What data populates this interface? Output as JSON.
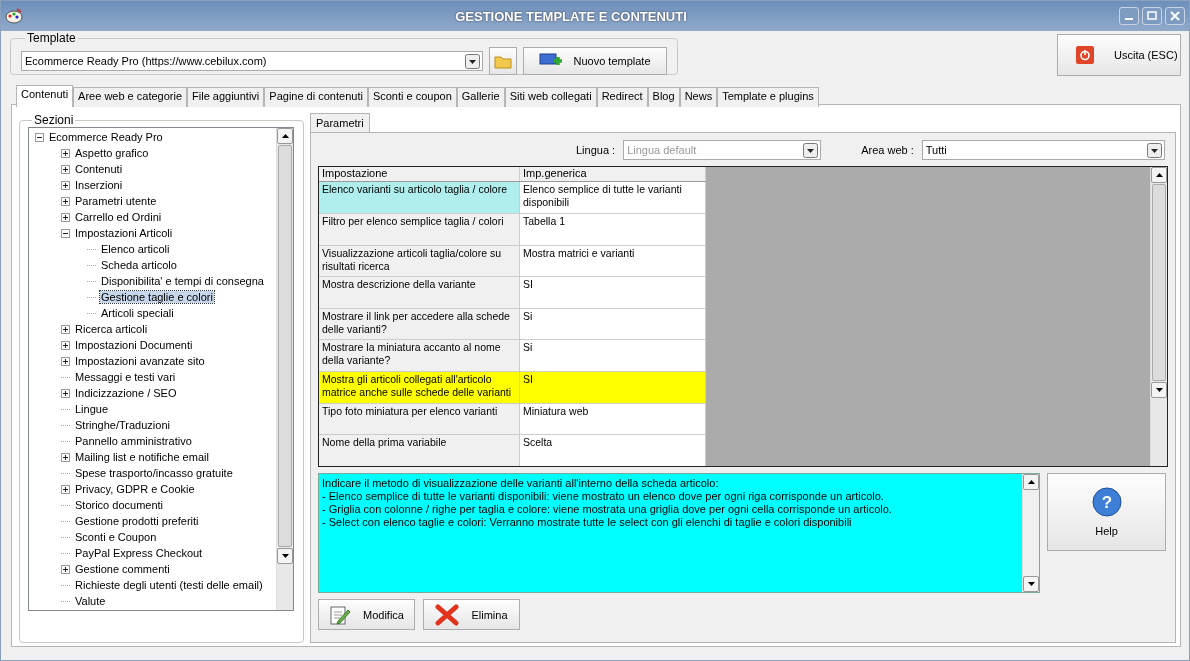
{
  "window": {
    "title": "GESTIONE TEMPLATE E CONTENUTI"
  },
  "template": {
    "label": "Template",
    "value": "Ecommerce Ready Pro (https://www.cebilux.com)",
    "new_button": "Nuovo template"
  },
  "exit_button": "Uscita (ESC)",
  "tabs": [
    {
      "label": "Contenuti",
      "selected": true
    },
    {
      "label": "Aree web e categorie",
      "selected": false
    },
    {
      "label": "File aggiuntivi",
      "selected": false
    },
    {
      "label": "Pagine di contenuti",
      "selected": false
    },
    {
      "label": "Sconti e coupon",
      "selected": false
    },
    {
      "label": "Gallerie",
      "selected": false
    },
    {
      "label": "Siti web collegati",
      "selected": false
    },
    {
      "label": "Redirect",
      "selected": false
    },
    {
      "label": "Blog",
      "selected": false
    },
    {
      "label": "News",
      "selected": false
    },
    {
      "label": "Template e plugins",
      "selected": false
    }
  ],
  "sidebar": {
    "title": "Sezioni",
    "items": [
      {
        "label": "Ecommerce Ready Pro",
        "expanded": true,
        "selected": false,
        "children": [
          {
            "label": "Aspetto grafico",
            "expanded": false,
            "selected": false
          },
          {
            "label": "Contenuti",
            "expanded": false,
            "selected": false
          },
          {
            "label": "Inserzioni",
            "expanded": false,
            "selected": false
          },
          {
            "label": "Parametri utente",
            "expanded": false,
            "selected": false
          },
          {
            "label": "Carrello ed Ordini",
            "expanded": false,
            "selected": false
          },
          {
            "label": "Impostazioni Articoli",
            "expanded": true,
            "selected": false,
            "children": [
              {
                "label": "Elenco articoli",
                "selected": false
              },
              {
                "label": "Scheda articolo",
                "selected": false
              },
              {
                "label": "Disponibilita' e tempi di consegna",
                "selected": false
              },
              {
                "label": "Gestione taglie e colori",
                "selected": true
              },
              {
                "label": "Articoli speciali",
                "selected": false
              }
            ]
          },
          {
            "label": "Ricerca articoli",
            "expanded": false,
            "selected": false
          },
          {
            "label": "Impostazioni Documenti",
            "expanded": false,
            "selected": false
          },
          {
            "label": "Impostazioni avanzate sito",
            "expanded": false,
            "selected": false
          },
          {
            "label": "Messaggi e testi vari",
            "selected": false
          },
          {
            "label": "Indicizzazione / SEO",
            "expanded": false,
            "selected": false
          },
          {
            "label": "Lingue",
            "selected": false
          },
          {
            "label": "Stringhe/Traduzioni",
            "selected": false
          },
          {
            "label": "Pannello amministrativo",
            "selected": false
          },
          {
            "label": "Mailing list e notifiche email",
            "expanded": false,
            "selected": false
          },
          {
            "label": "Spese trasporto/incasso gratuite",
            "selected": false
          },
          {
            "label": "Privacy, GDPR e Cookie",
            "expanded": false,
            "selected": false
          },
          {
            "label": "Storico documenti",
            "selected": false
          },
          {
            "label": "Gestione prodotti preferiti",
            "selected": false
          },
          {
            "label": "Sconti e Coupon",
            "selected": false
          },
          {
            "label": "PayPal Express Checkout",
            "selected": false
          },
          {
            "label": "Gestione commenti",
            "expanded": false,
            "selected": false
          },
          {
            "label": "Richieste degli utenti (testi delle email)",
            "selected": false
          },
          {
            "label": "Valute",
            "selected": false
          }
        ]
      }
    ]
  },
  "panel_tabs": [
    {
      "label": "Parametri",
      "selected": true
    }
  ],
  "filters": {
    "language_label": "Lingua :",
    "language_value": "Lingua default",
    "language_disabled": true,
    "area_label": "Area web :",
    "area_value": "Tutti"
  },
  "table": {
    "columns": [
      "Impostazione",
      "Imp.generica"
    ],
    "rows": [
      {
        "setting": "Elenco varianti su articolo taglia / colore",
        "value": "Elenco semplice di tutte le varianti disponibili",
        "selected": true,
        "highlighted": false
      },
      {
        "setting": "Filtro per elenco semplice taglia / colori",
        "value": "Tabella 1",
        "selected": false,
        "highlighted": false
      },
      {
        "setting": "Visualizzazione articoli taglia/colore su risultati ricerca",
        "value": "Mostra matrici e varianti",
        "selected": false,
        "highlighted": false
      },
      {
        "setting": "Mostra descrizione della variante",
        "value": "SI",
        "selected": false,
        "highlighted": false
      },
      {
        "setting": "Mostrare il link per accedere alla schede delle varianti?",
        "value": "Si",
        "selected": false,
        "highlighted": false
      },
      {
        "setting": "Mostrare la miniatura accanto al nome della variante?",
        "value": "Si",
        "selected": false,
        "highlighted": false
      },
      {
        "setting": "Mostra gli articoli collegati all'articolo matrice anche sulle schede delle varianti",
        "value": "SI",
        "selected": false,
        "highlighted": true
      },
      {
        "setting": "Tipo foto miniatura per elenco varianti",
        "value": "Miniatura web",
        "selected": false,
        "highlighted": false
      },
      {
        "setting": "Nome della prima variabile",
        "value": "Scelta",
        "selected": false,
        "highlighted": false
      }
    ]
  },
  "description": [
    "Indicare il metodo di visualizzazione delle varianti all'interno della scheda articolo:",
    "- Elenco semplice di tutte le varianti disponibili: viene mostrato un elenco dove per ogni riga corrisponde un articolo.",
    "- Griglia con colonne / righe per taglia e colore: viene mostrata una griglia dove per ogni cella corrisponde un articolo.",
    "- Select con elenco taglie e colori: Verranno mostrate tutte le select con gli elenchi di taglie e colori disponibili"
  ],
  "help_button": "Help",
  "help_icon": "?",
  "buttons": [
    {
      "label": "Modifica",
      "kind": "edit"
    },
    {
      "label": "Elimina",
      "kind": "delete"
    }
  ]
}
